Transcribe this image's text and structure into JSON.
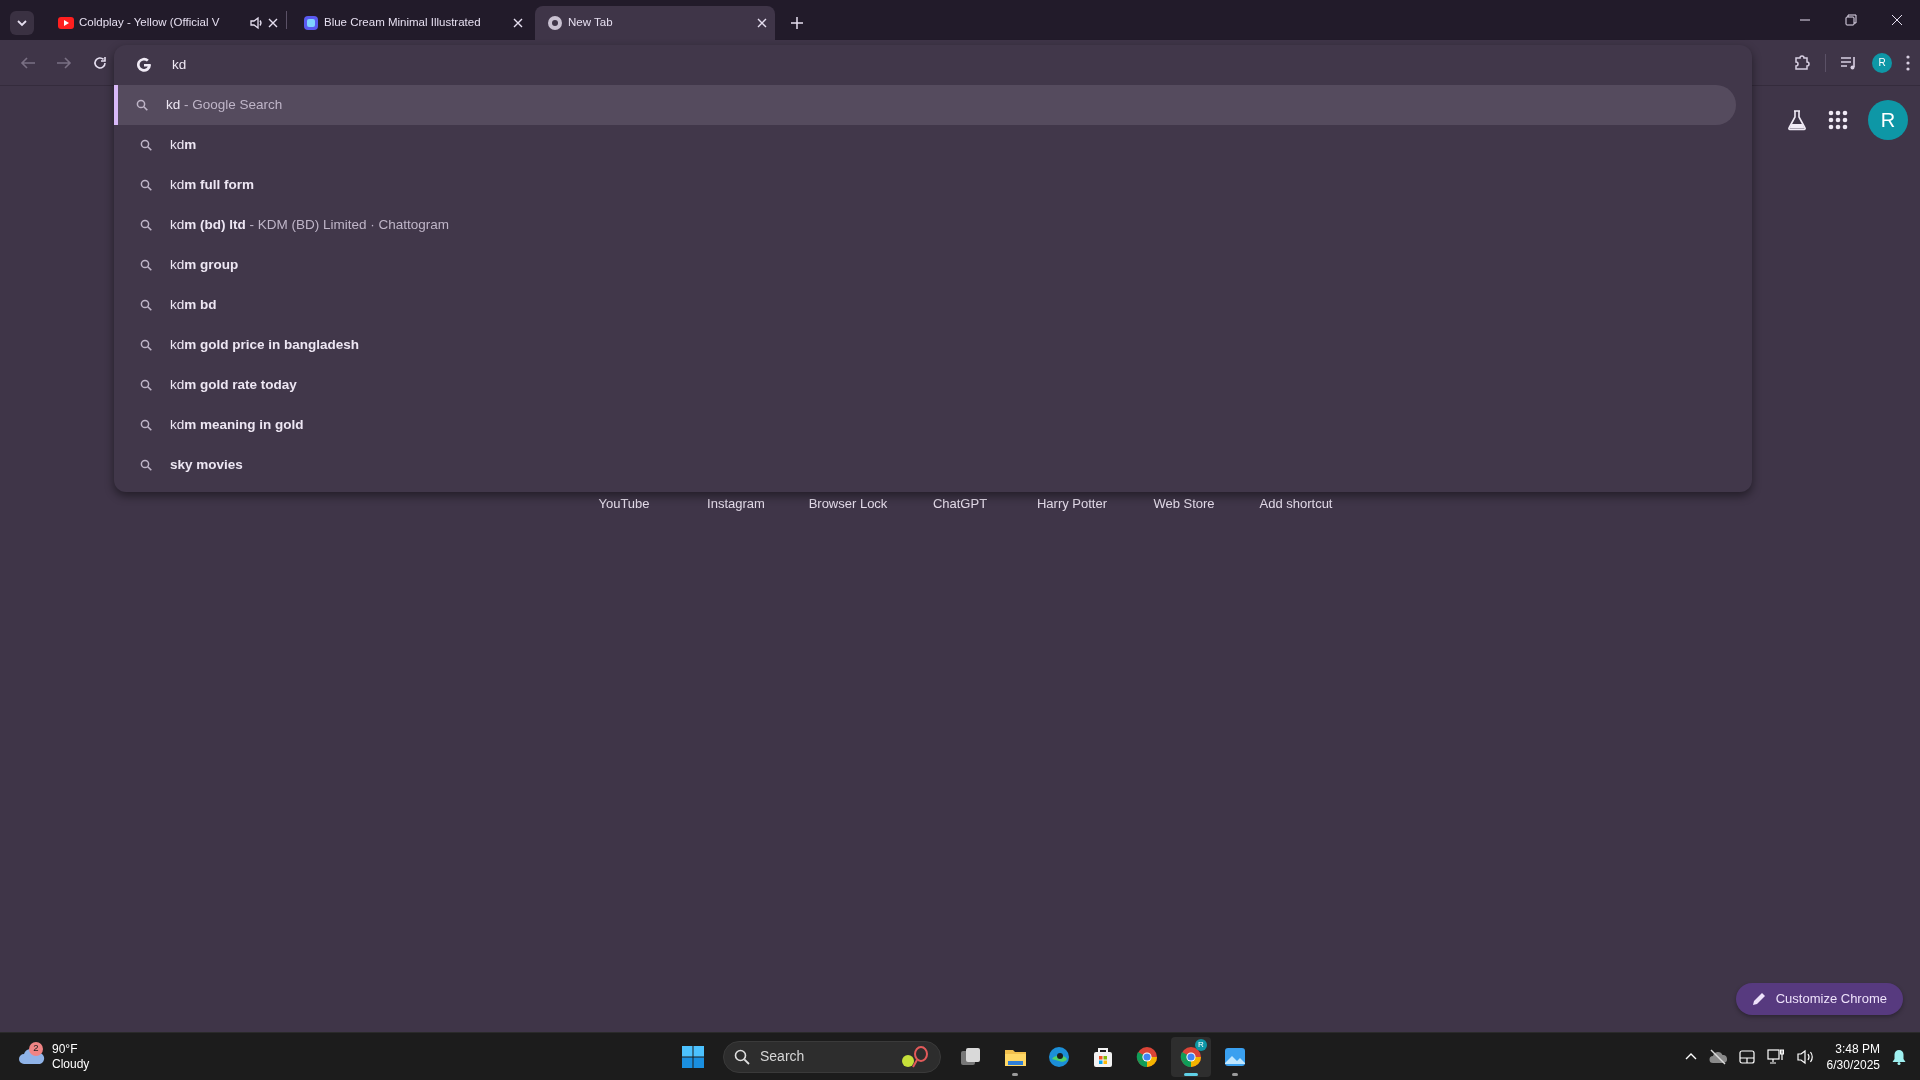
{
  "tabs": [
    {
      "kind": "video",
      "title": "Coldplay - Yellow (Official V",
      "audio": true,
      "selected": false
    },
    {
      "kind": "doc",
      "title": "Blue Cream Minimal Illustrated",
      "audio": false,
      "selected": false
    },
    {
      "kind": "newtab",
      "title": "New Tab",
      "audio": false,
      "selected": true
    }
  ],
  "nav_buttons": [
    {
      "kind": "back",
      "disabled": true
    },
    {
      "kind": "forward",
      "disabled": true
    },
    {
      "kind": "reload",
      "disabled": false
    }
  ],
  "omnibox": {
    "value": "kd"
  },
  "suggestions": [
    {
      "text": "kd",
      "detail": "- Google Search",
      "selected": true
    },
    {
      "text": "kd**m**",
      "selected": false
    },
    {
      "text": "kd**m full form**",
      "selected": false
    },
    {
      "text": "kd**m (bd) ltd**",
      "detail": "- KDM (BD) Limited · Chattogram",
      "selected": false
    },
    {
      "text": "kd**m group**",
      "selected": false
    },
    {
      "text": "kd**m bd**",
      "selected": false
    },
    {
      "text": "kd**m gold price in bangladesh**",
      "selected": false
    },
    {
      "text": "kd**m gold rate today**",
      "selected": false
    },
    {
      "text": "kd**m meaning in gold**",
      "selected": false
    },
    {
      "text": "**sky movies**",
      "selected": false
    }
  ],
  "toolbar_avatar": "R",
  "page_avatar": "R",
  "shortcuts": [
    "YouTube",
    "Instagram",
    "Browser Lock",
    "ChatGPT",
    "Harry Potter",
    "Web Store",
    "Add shortcut"
  ],
  "customize_button": "Customize Chrome",
  "taskbar": {
    "weather": {
      "badge": "2",
      "temperature": "90°F",
      "condition": "Cloudy"
    },
    "search_placeholder": "Search",
    "apps": [
      {
        "kind": "taskview",
        "running": false,
        "selected": false
      },
      {
        "kind": "explorer",
        "running": true,
        "selected": false
      },
      {
        "kind": "edge",
        "running": false,
        "selected": false
      },
      {
        "kind": "store",
        "running": false,
        "selected": false
      },
      {
        "kind": "chrome",
        "running": false,
        "selected": false
      },
      {
        "kind": "chrome",
        "badge": "R",
        "running": true,
        "selected": true
      },
      {
        "kind": "photos",
        "running": true,
        "selected": false
      }
    ],
    "time": "3:48 PM",
    "date": "6/30/2025"
  }
}
